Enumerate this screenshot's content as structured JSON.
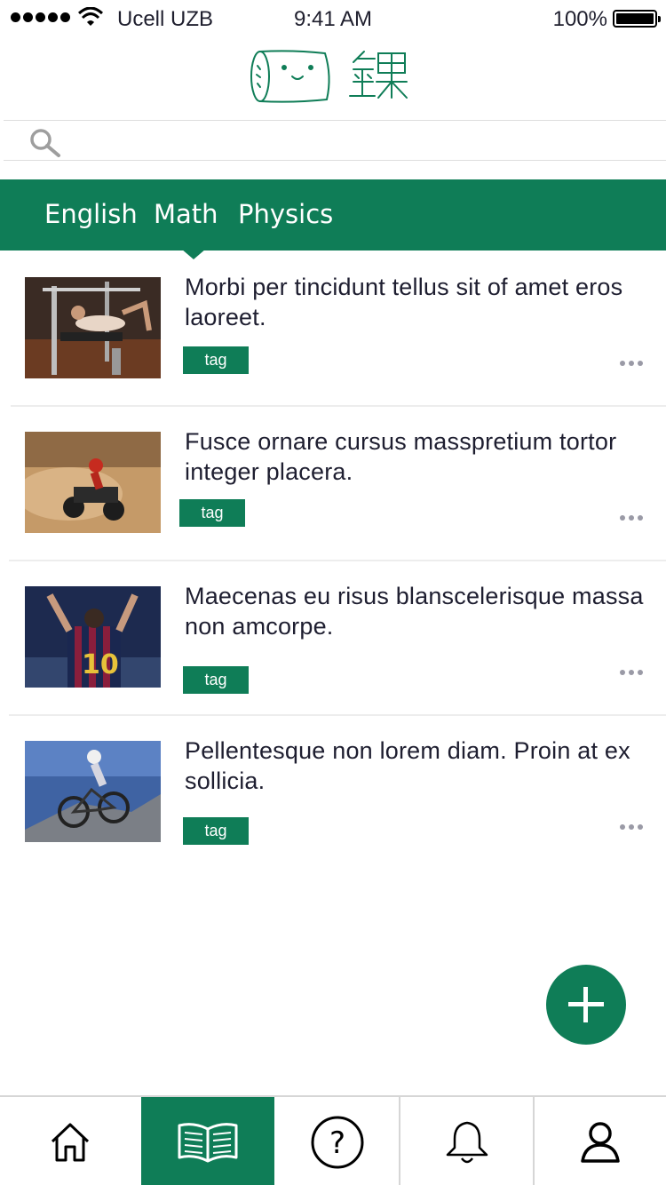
{
  "status_bar": {
    "carrier": "Ucell UZB",
    "time": "9:41 AM",
    "battery": "100%"
  },
  "search": {
    "placeholder": ""
  },
  "tabs": [
    {
      "label": "English"
    },
    {
      "label": "Math"
    },
    {
      "label": "Physics"
    }
  ],
  "articles": [
    {
      "title": "Morbi per tincidunt tellus sit of amet eros laoreet.",
      "tag": "tag",
      "thumbnail": "gym-workout-photo"
    },
    {
      "title": "Fusce ornare cursus masspretium tortor integer placera.",
      "tag": "tag",
      "thumbnail": "atv-desert-photo"
    },
    {
      "title": "Maecenas eu risus blanscelerisque massa non amcorpe.",
      "tag": "tag",
      "thumbnail": "football-player-photo"
    },
    {
      "title": "Pellentesque non lorem diam. Proin at ex sollicia.",
      "tag": "tag",
      "thumbnail": "mountain-bike-photo"
    }
  ],
  "nav": [
    {
      "icon": "home-icon"
    },
    {
      "icon": "book-icon",
      "active": true
    },
    {
      "icon": "question-icon"
    },
    {
      "icon": "bell-icon"
    },
    {
      "icon": "user-icon"
    }
  ],
  "colors": {
    "accent": "#0f7d57",
    "title_text": "#1e1e30",
    "divider": "#ededed"
  }
}
